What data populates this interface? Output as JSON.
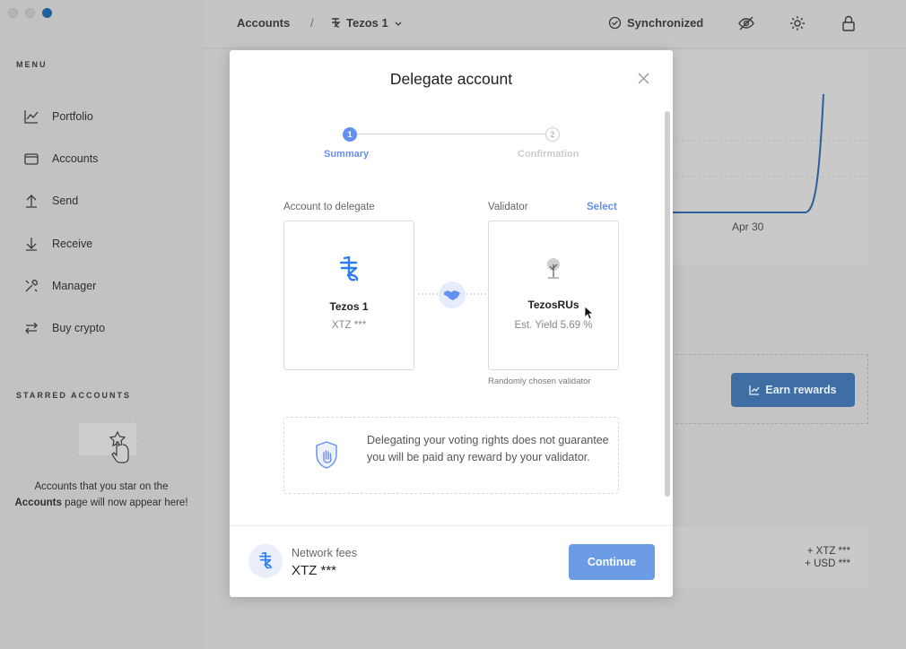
{
  "sidebar": {
    "menu_title": "MENU",
    "items": [
      {
        "label": "Portfolio",
        "icon": "chart-icon"
      },
      {
        "label": "Accounts",
        "icon": "wallet-icon"
      },
      {
        "label": "Send",
        "icon": "send-icon"
      },
      {
        "label": "Receive",
        "icon": "receive-icon"
      },
      {
        "label": "Manager",
        "icon": "tools-icon"
      },
      {
        "label": "Buy crypto",
        "icon": "exchange-icon"
      }
    ],
    "starred_title": "STARRED ACCOUNTS",
    "starred_text_1": "Accounts that you star on the",
    "starred_text_bold": "Accounts",
    "starred_text_2": "page will now appear here!"
  },
  "topbar": {
    "breadcrumb_root": "Accounts",
    "breadcrumb_separator": "/",
    "breadcrumb_account": "Tezos 1",
    "sync_status": "Synchronized"
  },
  "background": {
    "chart_axis_label": "Apr 30",
    "earn_rewards_label": "Earn rewards",
    "balance_xtz": "+ XTZ ***",
    "balance_usd": "+ USD ***"
  },
  "modal": {
    "title": "Delegate account",
    "steps": [
      {
        "number": "1",
        "label": "Summary",
        "state": "active"
      },
      {
        "number": "2",
        "label": "Confirmation",
        "state": "inactive"
      }
    ],
    "account_label": "Account to delegate",
    "account_name": "Tezos 1",
    "account_balance": "XTZ ***",
    "validator_label": "Validator",
    "select_label": "Select",
    "validator_name": "TezosRUs",
    "validator_yield": "Est. Yield 5.69 %",
    "random_note": "Randomly chosen validator",
    "info_text": "Delegating your voting rights does not guarantee you will be paid any reward by your validator.",
    "fees_label": "Network fees",
    "fees_value": "XTZ ***",
    "continue_label": "Continue"
  },
  "colors": {
    "accent": "#6490f1",
    "button": "#6d9ce6",
    "tezos_blue": "#2c7df7"
  }
}
